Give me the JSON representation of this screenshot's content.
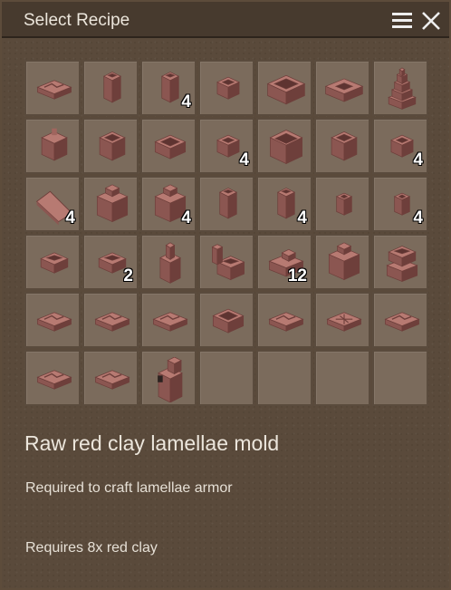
{
  "window": {
    "title": "Select Recipe"
  },
  "icons": {
    "menu": "hamburger-menu-icon",
    "close": "close-icon"
  },
  "colors": {
    "clay_top": "#b77a72",
    "clay_side": "#8b5651",
    "clay_dark": "#6e3f3b",
    "slot_bg": "#7b6b5c"
  },
  "recipes": [
    {
      "shape": "flat-mold",
      "qty": ""
    },
    {
      "shape": "tall-block",
      "qty": ""
    },
    {
      "shape": "tall-block",
      "qty": "4"
    },
    {
      "shape": "small-box",
      "qty": ""
    },
    {
      "shape": "trough",
      "qty": ""
    },
    {
      "shape": "long-mold",
      "qty": ""
    },
    {
      "shape": "tiered-stack",
      "qty": ""
    },
    {
      "shape": "barrel",
      "qty": ""
    },
    {
      "shape": "pot",
      "qty": ""
    },
    {
      "shape": "open-box",
      "qty": ""
    },
    {
      "shape": "small-box",
      "qty": "4"
    },
    {
      "shape": "big-box",
      "qty": ""
    },
    {
      "shape": "pot",
      "qty": ""
    },
    {
      "shape": "small-box",
      "qty": "4"
    },
    {
      "shape": "slab",
      "qty": "4"
    },
    {
      "shape": "big-jar",
      "qty": ""
    },
    {
      "shape": "big-jar",
      "qty": "4"
    },
    {
      "shape": "tall-block",
      "qty": ""
    },
    {
      "shape": "tall-block",
      "qty": "4"
    },
    {
      "shape": "small-block",
      "qty": ""
    },
    {
      "shape": "small-block",
      "qty": "4"
    },
    {
      "shape": "low-box",
      "qty": ""
    },
    {
      "shape": "low-box",
      "qty": "2"
    },
    {
      "shape": "chimney",
      "qty": ""
    },
    {
      "shape": "kiln",
      "qty": ""
    },
    {
      "shape": "ingot-mold",
      "qty": "12"
    },
    {
      "shape": "big-jar",
      "qty": ""
    },
    {
      "shape": "anvil",
      "qty": ""
    },
    {
      "shape": "flat-mold",
      "qty": ""
    },
    {
      "shape": "flat-mold",
      "qty": ""
    },
    {
      "shape": "flat-mold",
      "qty": ""
    },
    {
      "shape": "open-box",
      "qty": ""
    },
    {
      "shape": "flat-mold",
      "qty": ""
    },
    {
      "shape": "grid-mold",
      "qty": ""
    },
    {
      "shape": "flat-mold",
      "qty": ""
    },
    {
      "shape": "flat-mold",
      "qty": ""
    },
    {
      "shape": "flat-mold",
      "qty": ""
    },
    {
      "shape": "stove",
      "qty": ""
    },
    {
      "shape": "empty",
      "qty": ""
    },
    {
      "shape": "empty",
      "qty": ""
    },
    {
      "shape": "empty",
      "qty": ""
    },
    {
      "shape": "empty",
      "qty": ""
    }
  ],
  "selected": {
    "name": "Raw red clay lamellae mold",
    "description": "Required to craft lamellae armor",
    "requirement": "Requires 8x red clay"
  }
}
